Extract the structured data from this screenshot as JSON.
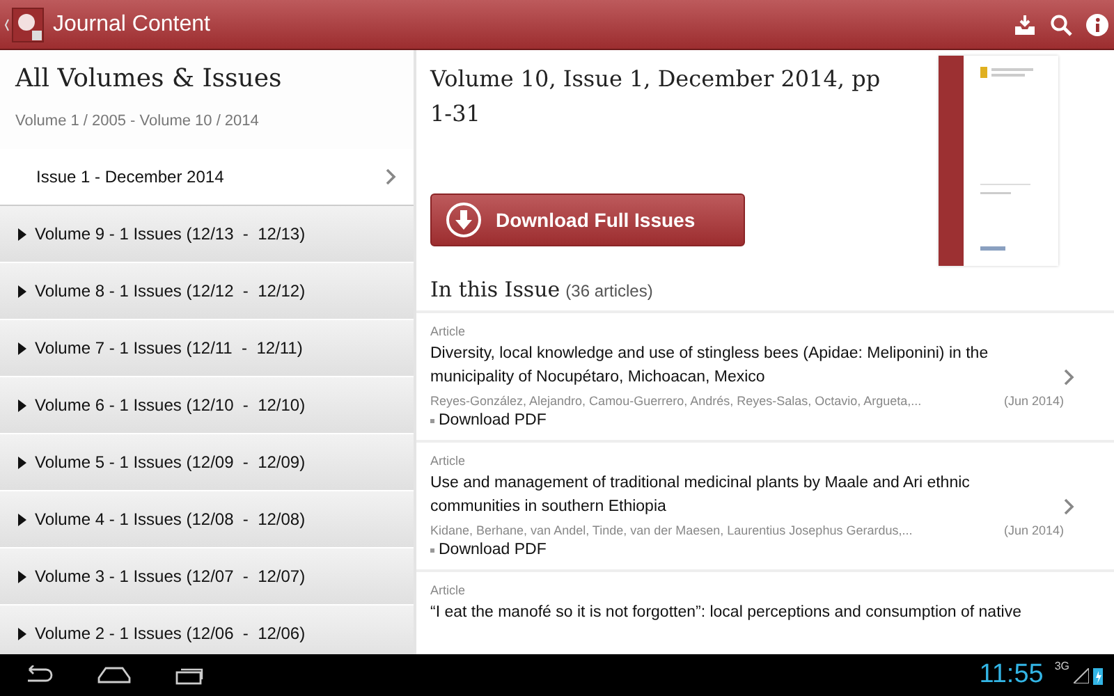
{
  "app_bar": {
    "title": "Journal Content"
  },
  "sidebar": {
    "title": "All Volumes & Issues",
    "subtitle": "Volume 1 / 2005 - Volume 10 / 2014",
    "items": [
      {
        "label": "Issue 1 - December 2014",
        "kind": "issue"
      },
      {
        "label": "Volume 9 - 1 Issues (12/13  -  12/13)",
        "kind": "volume"
      },
      {
        "label": "Volume 8 - 1 Issues (12/12  -  12/12)",
        "kind": "volume"
      },
      {
        "label": "Volume 7 - 1 Issues (12/11  -  12/11)",
        "kind": "volume"
      },
      {
        "label": "Volume 6 - 1 Issues (12/10  -  12/10)",
        "kind": "volume"
      },
      {
        "label": "Volume 5 - 1 Issues (12/09  -  12/09)",
        "kind": "volume"
      },
      {
        "label": "Volume 4 - 1 Issues (12/08  -  12/08)",
        "kind": "volume"
      },
      {
        "label": "Volume 3 - 1 Issues (12/07  -  12/07)",
        "kind": "volume"
      },
      {
        "label": "Volume 2 - 1 Issues (12/06  -  12/06)",
        "kind": "volume"
      }
    ]
  },
  "issue": {
    "title": "Volume 10, Issue 1, December 2014, pp 1-31",
    "download_button": "Download Full Issues",
    "section_title": "In this Issue",
    "article_count": "(36 articles)",
    "articles": [
      {
        "type": "Article",
        "title": "Diversity, local knowledge and use of stingless bees (Apidae: Meliponini) in the municipality of Nocupétaro, Michoacan, Mexico",
        "authors": "Reyes-González, Alejandro, Camou-Guerrero, Andrés, Reyes-Salas, Octavio, Argueta,...",
        "date": "(Jun 2014)",
        "link": "Download PDF"
      },
      {
        "type": "Article",
        "title": "Use and management of traditional medicinal plants by Maale and Ari ethnic communities in southern Ethiopia",
        "authors": "Kidane, Berhane, van Andel, Tinde, van der Maesen, Laurentius Josephus Gerardus,...",
        "date": "(Jun 2014)",
        "link": "Download PDF"
      },
      {
        "type": "Article",
        "title": "“I eat the manofé so it is not forgotten”: local perceptions and consumption of native"
      }
    ]
  },
  "nav_bar": {
    "time": "11:55",
    "network": "3G"
  }
}
